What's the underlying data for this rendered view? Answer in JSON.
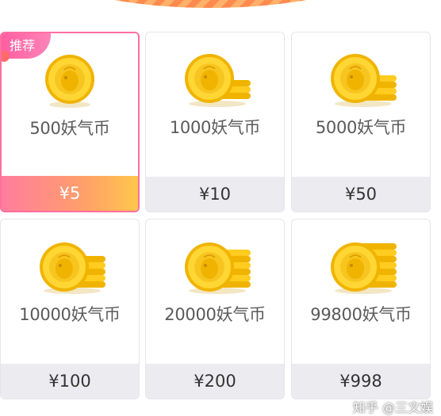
{
  "badge": {
    "label": "推荐"
  },
  "colors": {
    "accent_pink": "#ff6fa0",
    "coin_gold": "#f7c520",
    "price_bar_gray": "#ececf0"
  },
  "packages": [
    {
      "amount": "500妖气币",
      "price": "¥5",
      "selected": true,
      "coin_icon": "coin-single-icon"
    },
    {
      "amount": "1000妖气币",
      "price": "¥10",
      "selected": false,
      "coin_icon": "coin-stack-icon"
    },
    {
      "amount": "5000妖气币",
      "price": "¥50",
      "selected": false,
      "coin_icon": "coin-stack-icon"
    },
    {
      "amount": "10000妖气币",
      "price": "¥100",
      "selected": false,
      "coin_icon": "coin-stack-icon"
    },
    {
      "amount": "20000妖气币",
      "price": "¥200",
      "selected": false,
      "coin_icon": "coin-stack-icon"
    },
    {
      "amount": "99800妖气币",
      "price": "¥998",
      "selected": false,
      "coin_icon": "coin-stack-icon"
    }
  ],
  "watermark": {
    "text": "知乎 @三文娱"
  }
}
